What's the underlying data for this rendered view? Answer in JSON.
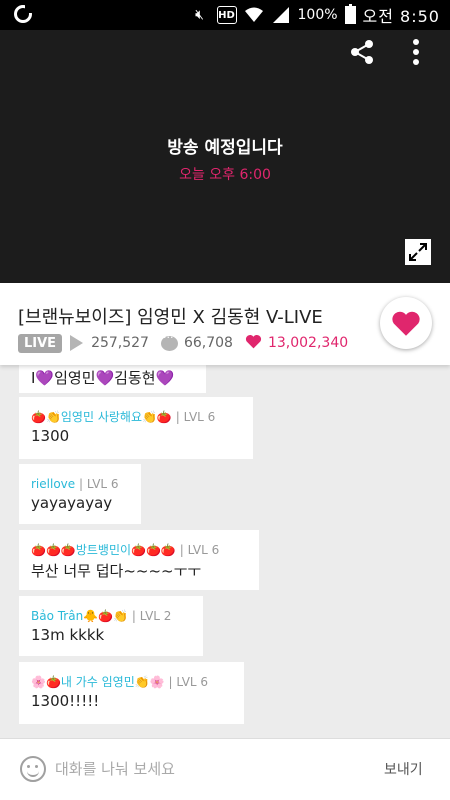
{
  "status_bar": {
    "hd_label": "HD",
    "battery": "100%",
    "time": "오전 8:50"
  },
  "video": {
    "title": "방송 예정입니다",
    "subtitle": "오늘 오후 6:00",
    "accent_color": "#e0266d"
  },
  "info": {
    "title": "[브랜뉴보이즈] 임영민 X 김동현 V-LIVE",
    "live_badge": "LIVE",
    "views": "257,527",
    "comments": "66,708",
    "likes": "13,002,340"
  },
  "chat": {
    "messages": [
      {
        "name": "",
        "level": "",
        "text": "I💜임영민💜김동현💜"
      },
      {
        "name": "🍅👏임영민 사랑해요👏🍅",
        "level": "LVL 6",
        "text": "1300"
      },
      {
        "name": "riellove",
        "level": "LVL 6",
        "text": "yayayayay"
      },
      {
        "name": "🍅🍅🍅방트뱅민이🍅🍅🍅",
        "level": "LVL 6",
        "text": "부산 너무 덥다~~~~ㅜㅜ"
      },
      {
        "name": "Bảo Trân🐥🍅👏",
        "level": "LVL 2",
        "text": "13m kkkk"
      },
      {
        "name": "🌸🍅내 가수 임영민👏🌸",
        "level": "LVL 6",
        "text": "1300!!!!!"
      }
    ],
    "level_separator": "|"
  },
  "input": {
    "placeholder": "대화를 나눠 보세요",
    "send_label": "보내기"
  }
}
